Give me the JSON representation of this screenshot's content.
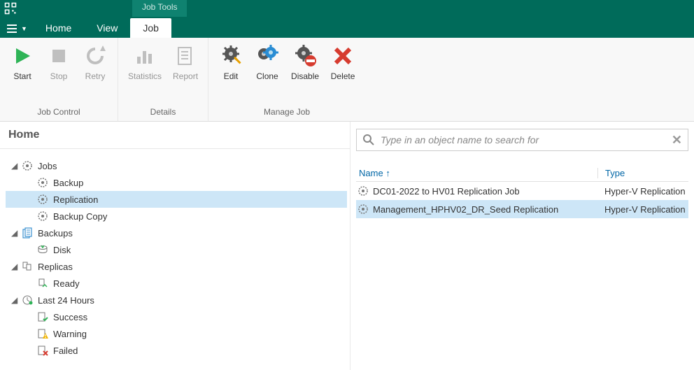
{
  "app": {
    "tools_tab": "Job Tools"
  },
  "menubar": {
    "home": "Home",
    "view": "View",
    "job": "Job"
  },
  "ribbon": {
    "job_control": {
      "title": "Job Control",
      "start": "Start",
      "stop": "Stop",
      "retry": "Retry"
    },
    "details": {
      "title": "Details",
      "statistics": "Statistics",
      "report": "Report"
    },
    "manage": {
      "title": "Manage Job",
      "edit": "Edit",
      "clone": "Clone",
      "disable": "Disable",
      "delete": "Delete"
    }
  },
  "nav": {
    "heading": "Home",
    "jobs": {
      "label": "Jobs",
      "backup": "Backup",
      "replication": "Replication",
      "backup_copy": "Backup Copy"
    },
    "backups": {
      "label": "Backups",
      "disk": "Disk"
    },
    "replicas": {
      "label": "Replicas",
      "ready": "Ready"
    },
    "last24": {
      "label": "Last 24 Hours",
      "success": "Success",
      "warning": "Warning",
      "failed": "Failed"
    }
  },
  "search": {
    "placeholder": "Type in an object name to search for"
  },
  "grid": {
    "col_name": "Name",
    "col_type": "Type",
    "sort_arrow": "↑",
    "rows": [
      {
        "name": "DC01-2022 to HV01 Replication Job",
        "type": "Hyper-V Replication",
        "selected": false
      },
      {
        "name": "Management_HPHV02_DR_Seed Replication",
        "type": "Hyper-V Replication",
        "selected": true
      }
    ]
  }
}
